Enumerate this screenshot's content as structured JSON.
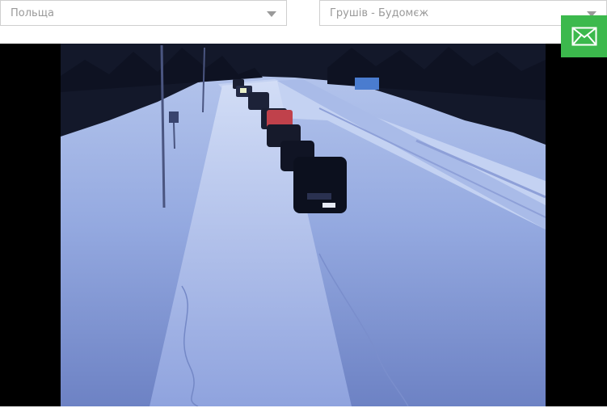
{
  "filters": {
    "country": {
      "value": "Польща"
    },
    "crossing": {
      "value": "Грушів - Будомєж"
    }
  },
  "contact": {
    "icon": "envelope-icon",
    "color": "#3cb94d"
  },
  "camera": {
    "scene": "snowy road with queue of cars at border crossing",
    "colors": {
      "snow": "#c8d6f2",
      "forest": "#13182a",
      "sky": "#3a4e80"
    }
  }
}
